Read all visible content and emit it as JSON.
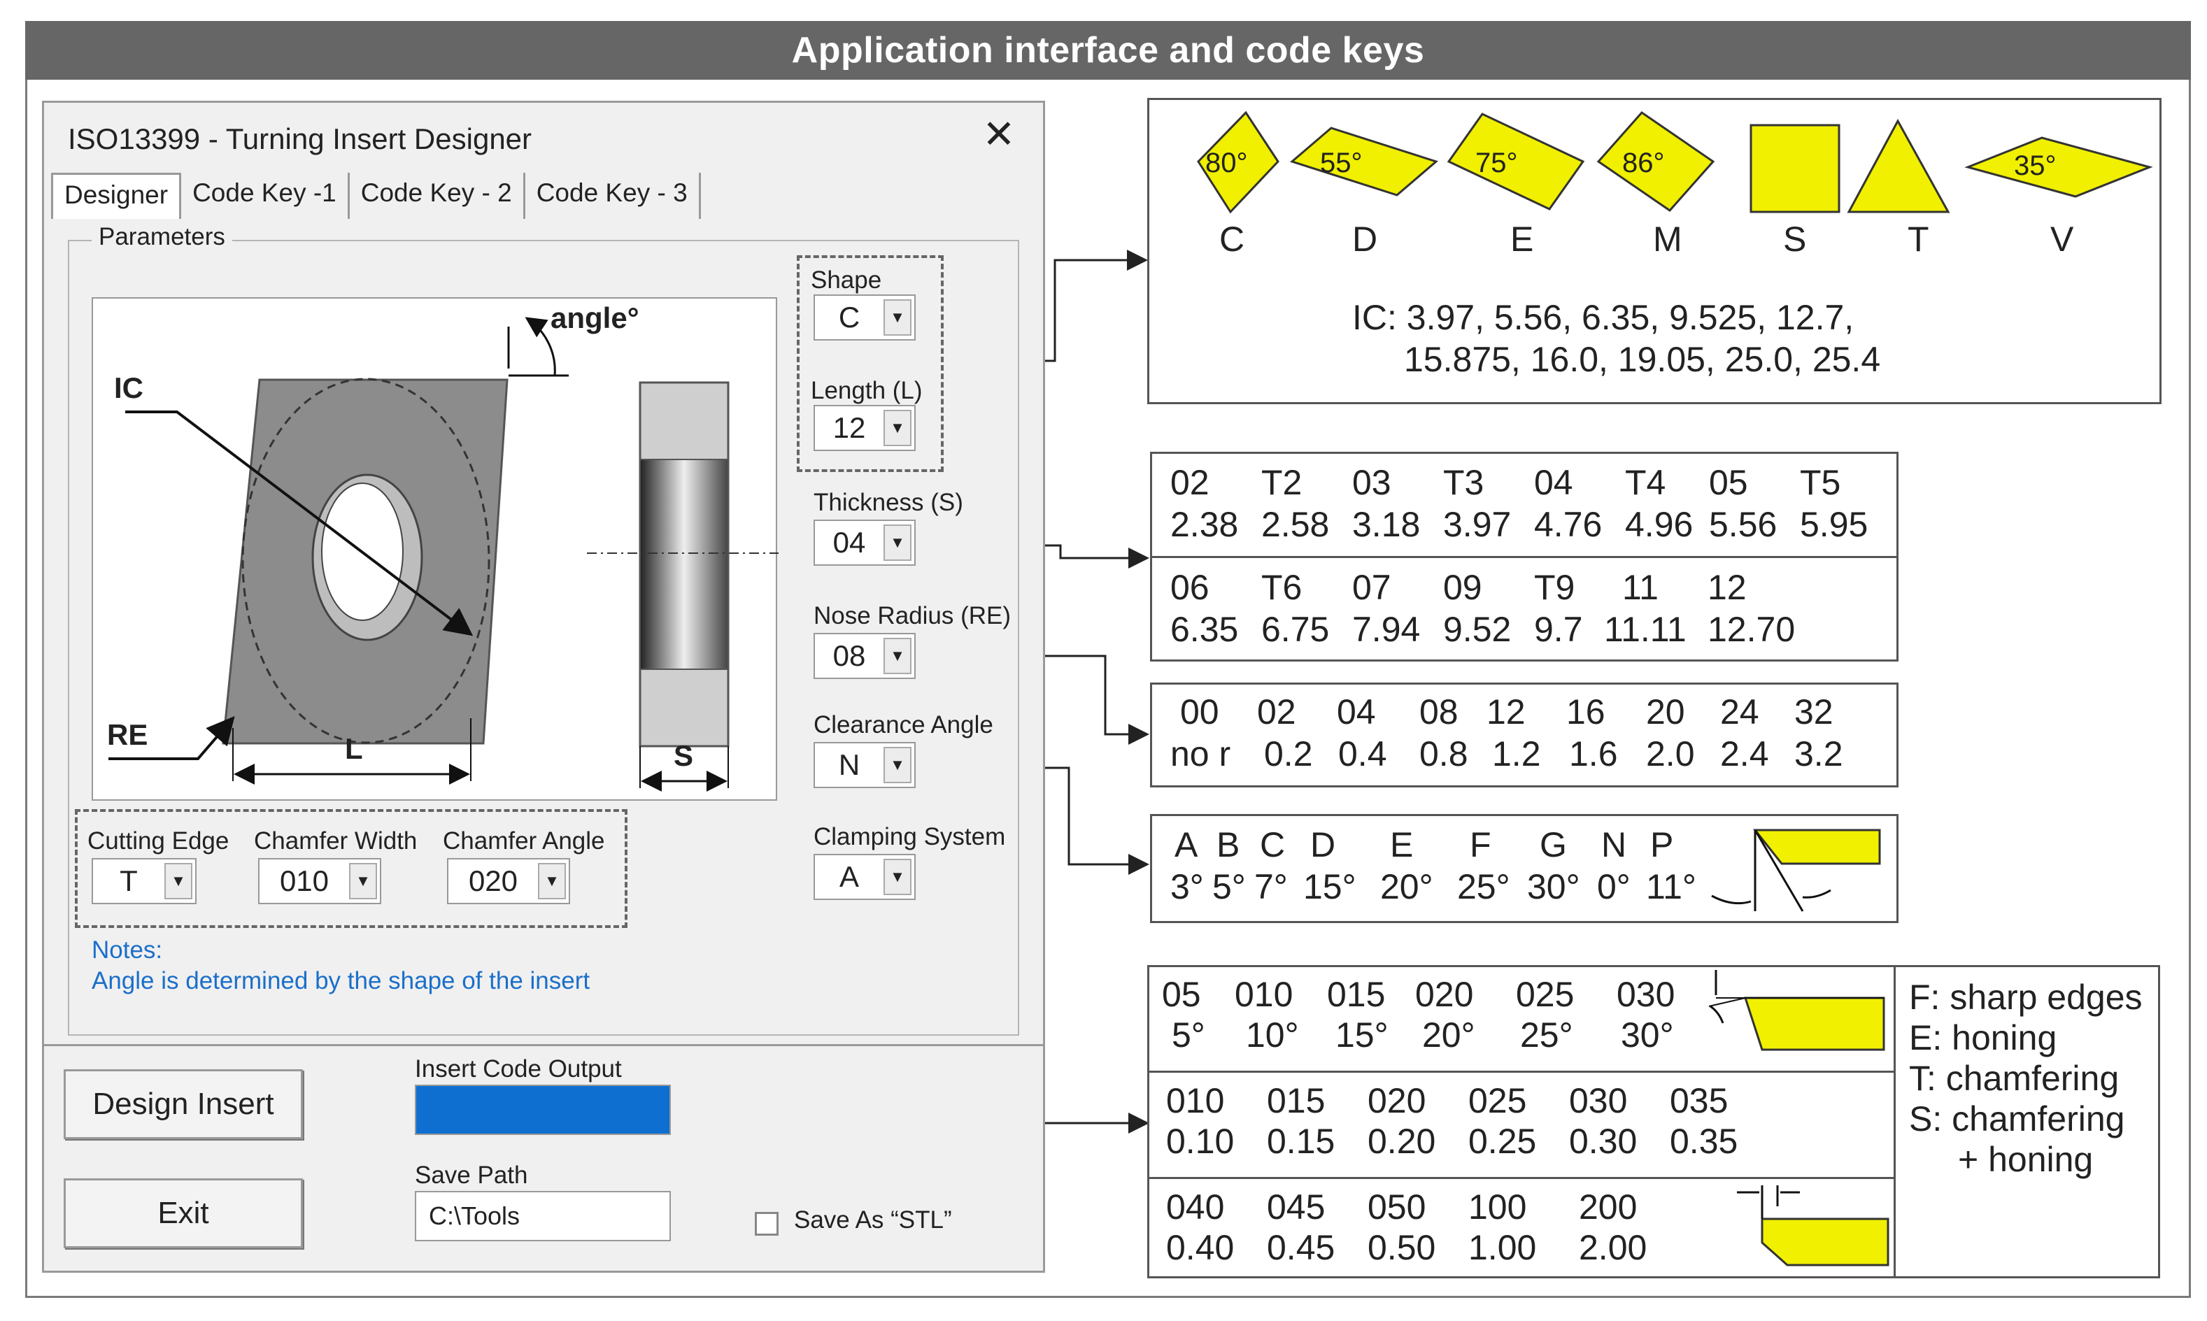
{
  "banner": {
    "title": "Application interface and code keys"
  },
  "window": {
    "title": "ISO13399 - Turning Insert Designer",
    "close": "✕",
    "tabs": [
      "Designer",
      "Code Key -1",
      "Code Key - 2",
      "Code Key - 3"
    ],
    "parameters_legend": "Parameters",
    "diagram_labels": {
      "angle": "angle°",
      "ic": "IC",
      "re": "RE",
      "l": "L",
      "s": "S"
    },
    "fields": {
      "shape": {
        "label": "Shape",
        "value": "C"
      },
      "length": {
        "label": "Length (L)",
        "value": "12"
      },
      "thickness": {
        "label": "Thickness (S)",
        "value": "04"
      },
      "nose_radius": {
        "label": "Nose Radius (RE)",
        "value": "08"
      },
      "clearance_angle": {
        "label": "Clearance Angle",
        "value": "N"
      },
      "clamping_system": {
        "label": "Clamping System",
        "value": "A"
      },
      "cutting_edge": {
        "label": "Cutting Edge",
        "value": "T"
      },
      "chamfer_width": {
        "label": "Chamfer Width",
        "value": "010"
      },
      "chamfer_angle": {
        "label": "Chamfer Angle",
        "value": "020"
      }
    },
    "notes": {
      "title": "Notes:",
      "text": "Angle is determined by the shape of the insert"
    },
    "buttons": {
      "design": "Design Insert",
      "exit": "Exit"
    },
    "output": {
      "label": "Insert Code Output",
      "value": ""
    },
    "save_path": {
      "label": "Save Path",
      "value": "C:\\Tools"
    },
    "save_stl": {
      "label": "Save As “STL”",
      "checked": false
    }
  },
  "code_keys": {
    "shapes": {
      "items": [
        {
          "code": "C",
          "angle": "80°"
        },
        {
          "code": "D",
          "angle": "55°"
        },
        {
          "code": "E",
          "angle": "75°"
        },
        {
          "code": "M",
          "angle": "86°"
        },
        {
          "code": "S",
          "angle": ""
        },
        {
          "code": "T",
          "angle": ""
        },
        {
          "code": "V",
          "angle": "35°"
        }
      ],
      "ic_line1": "IC: 3.97, 5.56, 6.35, 9.525, 12.7,",
      "ic_line2": "15.875, 16.0, 19.05, 25.0, 25.4"
    },
    "thickness": {
      "row1_codes": [
        "02",
        "T2",
        "03",
        "T3",
        "04",
        "T4",
        "05",
        "T5"
      ],
      "row1_values": [
        "2.38",
        "2.58",
        "3.18",
        "3.97",
        "4.76",
        "4.96",
        "5.56",
        "5.95"
      ],
      "row2_codes": [
        "06",
        "T6",
        "07",
        "09",
        "T9",
        "11",
        "12"
      ],
      "row2_values": [
        "6.35",
        "6.75",
        "7.94",
        "9.52",
        "9.7",
        "11.11",
        "12.70"
      ]
    },
    "nose_radius": {
      "codes": [
        "00",
        "02",
        "04",
        "08",
        "12",
        "16",
        "20",
        "24",
        "32"
      ],
      "values": [
        "no r",
        "0.2",
        "0.4",
        "0.8",
        "1.2",
        "1.6",
        "2.0",
        "2.4",
        "3.2"
      ]
    },
    "clearance": {
      "codes": [
        "A",
        "B",
        "C",
        "D",
        "E",
        "F",
        "G",
        "N",
        "P"
      ],
      "values": [
        "3°",
        "5°",
        "7°",
        "15°",
        "20°",
        "25°",
        "30°",
        "0°",
        "11°"
      ]
    },
    "chamfer": {
      "angle_codes": [
        "05",
        "010",
        "015",
        "020",
        "025",
        "030"
      ],
      "angle_values": [
        "5°",
        "10°",
        "15°",
        "20°",
        "25°",
        "30°"
      ],
      "width_codes_1": [
        "010",
        "015",
        "020",
        "025",
        "030",
        "035"
      ],
      "width_values_1": [
        "0.10",
        "0.15",
        "0.20",
        "0.25",
        "0.30",
        "0.35"
      ],
      "width_codes_2": [
        "040",
        "045",
        "050",
        "100",
        "200"
      ],
      "width_values_2": [
        "0.40",
        "0.45",
        "0.50",
        "1.00",
        "2.00"
      ],
      "edge_legend": [
        "F: sharp edges",
        "E: honing",
        "T: chamfering",
        "S: chamfering",
        "+ honing"
      ]
    }
  },
  "colors": {
    "highlight": "#f0f000",
    "banner": "#666666",
    "output_box": "#0e6fd0",
    "notes": "#1b6fc9"
  }
}
